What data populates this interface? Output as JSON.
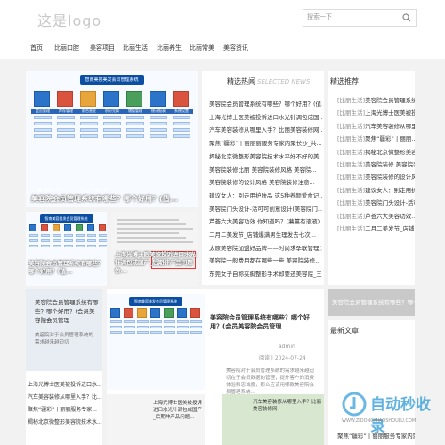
{
  "header": {
    "logo_text": "这是logo",
    "search_placeholder": "搜索一下"
  },
  "nav": {
    "items": [
      "首页",
      "比丽口腔",
      "美容项目",
      "比丽生活",
      "比丽养生",
      "比丽常美",
      "美容资讯"
    ]
  },
  "featured": {
    "system_title": "智南美容美发会员管理系统",
    "overlay_title": "美容院会员管理系统有哪些？哪个好用？(值...",
    "author": "admin",
    "date": "2024-07-24",
    "modules": [
      "会员管理",
      "库存管理",
      "前台营业",
      "积分兑换",
      "储值管理",
      "统计报表",
      "系统设置"
    ]
  },
  "hot": {
    "title": "精选热闻",
    "title_en": "SELECTED NEWS",
    "items": [
      "美容院会员管理系统有哪些？哪个好用？(值...",
      "上海光博士医美被投诉进口水光针调包成国...",
      "汽车美容装修从哪里入手？比丽美容装修网...",
      "聚焦“疆彩”丨丽丽丽服务专家内聚长沙_共...",
      "揭秘北京微整形美容院技术水平好不好的美...",
      "美容院装修比丽 美容院装修风格 美容院...",
      "美容院装修的设计风格 美容院装修注意...",
      "建议女人：别走用护肤品 这5种养颜爱食记...",
      "美容院门头设计-活可可创意设计(美容院门...",
      "芦荟六大美容功效 你知道吗？(蒹薑有液液)",
      "二月二美发节_店铺爆满男生理发去七次...",
      "太原美容院加盟好品牌——时尚求孕联管理(...",
      "美容院一般费用都在哪些一些 美容院装修...",
      "东莞女子自称夹脚整形手术却要还美容院_三..."
    ]
  },
  "side": {
    "title": "精选推荐",
    "items": [
      {
        "tag": "[比丽生活]",
        "text": "美容院会员管理系统..."
      },
      {
        "tag": "[比丽生活]",
        "text": "上海光博士医美被投..."
      },
      {
        "tag": "[比丽生活]",
        "text": "汽车美容装修从哪里..."
      },
      {
        "tag": "[比丽生活]",
        "text": "聚焦“疆彩”丨丽丽..."
      },
      {
        "tag": "[比丽生活]",
        "text": "揭秘北京微整形美容..."
      },
      {
        "tag": "[比丽生活]",
        "text": "美容院装修 美容院装..."
      },
      {
        "tag": "[比丽生活]",
        "text": "美容院装修的设计风格..."
      },
      {
        "tag": "[比丽生活]",
        "text": "建议女人：别走用护..."
      },
      {
        "tag": "[比丽生活]",
        "text": "美容院门头设计-活可..."
      },
      {
        "tag": "[比丽生活]",
        "text": "芦荟六大美容功效..."
      },
      {
        "tag": "[比丽生活]",
        "text": "二月二美发节_店铺..."
      }
    ],
    "banner_caption": "美容院会员管理系统有哪些？哪个..."
  },
  "mini": {
    "left_caption": "美容院会员管理系统有哪些？哪个好用？(值...",
    "right_caption": "上海光博士医美被投诉进口水光针调包成国产_后期伸产品问题依..."
  },
  "row3": {
    "left_title": "美容院会员管理系统有哪些？哪个好用？(会员美容院会员管理",
    "left_sub": "美容院对于会员管理系统的需求越来越迫切",
    "mid_title": "美容院会员管理系统有哪些？哪个好用？(会员美容院会员管理",
    "mid_author": "admin",
    "mid_date": "2024-07-24",
    "mid_tag": "阅读",
    "mid_body": "美容院对于会员管理系统的需求越来越迫切在于会员数据的管理，提升客户的消费体验和忠诚度，那么应该用哪款美容院会员管理系统...",
    "left_list": [
      "上海光博士医美被投诉进口水...",
      "汽车美容装修从哪里入手？比...",
      "聚焦“疆彩”丨丽丽服务专家...",
      "揭秘北京微整形美容院技术水..."
    ],
    "bottom_a": "上海光博士医美被投诉进口水光针调包成国产_后期伸产品问题...",
    "bottom_b": "汽车美容装修从哪里入手？比丽美容装修网"
  },
  "latest": {
    "title": "最新文章",
    "items": [
      "聚焦“疆彩”丨丽丽服务专家内聚长沙_共..."
    ]
  },
  "watermark": {
    "name": "自动秒收录",
    "url": "WWW.ZIDONGMIAOSHOULU.COM"
  },
  "colors": {
    "brand": "#0b4ea2",
    "accent": "#d9533f",
    "watermark": "#2c9ad6"
  }
}
